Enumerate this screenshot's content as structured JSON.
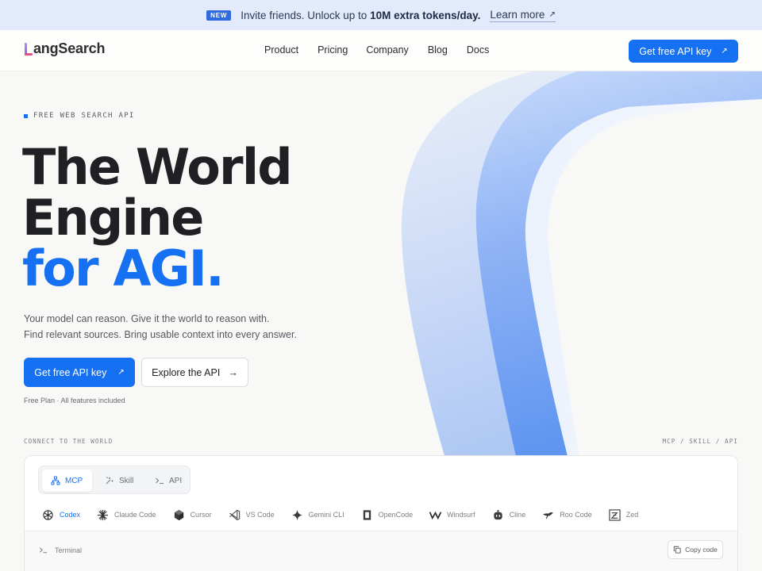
{
  "announcement": {
    "badge": "NEW",
    "message_prefix": "Invite friends. Unlock up to ",
    "message_bold": "10M extra tokens/day.",
    "link_label": "Learn more",
    "link_arrow": "↗"
  },
  "nav": {
    "logo_text": "angSearch",
    "links": [
      "Product",
      "Pricing",
      "Company",
      "Blog",
      "Docs"
    ],
    "cta_label": "Get free API key",
    "cta_arrow": "↗"
  },
  "hero": {
    "eyebrow": "FREE WEB SEARCH API",
    "title_line1": "The World",
    "title_line2": "Engine",
    "title_line3": "for AGI.",
    "subtitle_line1": "Your model can reason. Give it the world to reason with.",
    "subtitle_line2": "Find relevant sources. Bring usable context into every answer.",
    "primary_button": "Get free API key",
    "primary_arrow": "↗",
    "secondary_button": "Explore the API",
    "secondary_arrow": "→",
    "note": "Free Plan · All features included"
  },
  "connect": {
    "label_left": "CONNECT TO THE WORLD",
    "label_right": "MCP / SKILL / API",
    "tabs": [
      "MCP",
      "Skill",
      "API"
    ],
    "active_tab": "MCP",
    "tools": [
      "Codex",
      "Claude Code",
      "Cursor",
      "VS Code",
      "Gemini CLI",
      "OpenCode",
      "Windsurf",
      "Cline",
      "Roo Code",
      "Zed"
    ],
    "active_tool": "Codex",
    "terminal_label": "Terminal",
    "copy_label": "Copy code"
  },
  "colors": {
    "accent": "#1670f2",
    "announce_bg": "#e2eafc",
    "page_bg": "#f8f8f7"
  }
}
